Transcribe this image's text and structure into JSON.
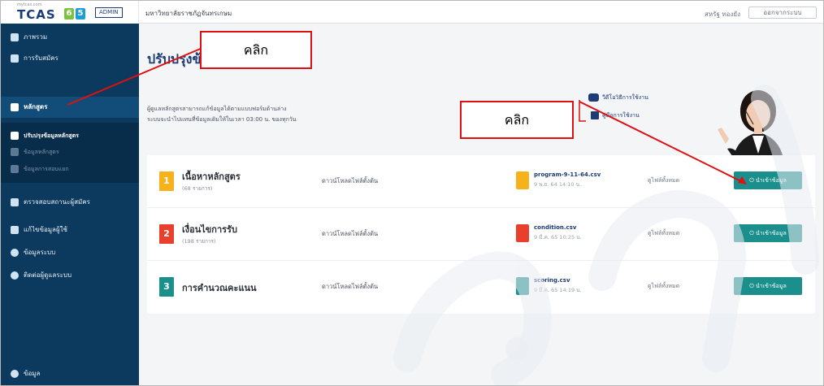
{
  "header": {
    "logo_sub": "mytcas.com",
    "logo_text": "TCAS",
    "logo_year_a": "6",
    "logo_year_b": "5",
    "admin_badge": "ADMIN",
    "university": "มหาวิทยาลัยราชภัฏจันทรเกษม",
    "user_name": "สหรัฐ ทองยัง",
    "logout_label": "ออกจากระบบ"
  },
  "sidebar": {
    "items": [
      {
        "label": "ภาพรวม",
        "icon": "building-icon"
      },
      {
        "label": "การรับสมัคร",
        "icon": "grid-icon"
      },
      {
        "label": "หลักสูตร",
        "icon": "curriculum-icon"
      },
      {
        "label": "ปรับปรุงข้อมูลหลักสูตร",
        "icon": "curriculum-edit-icon"
      },
      {
        "label": "ข้อมูลหลักสูตร",
        "icon": "list-icon"
      },
      {
        "label": "ข้อมูลการสอบแยก",
        "icon": "list-icon"
      },
      {
        "label": "ตรวจสอบสถานะผู้สมัคร",
        "icon": "people-icon"
      },
      {
        "label": "แก้ไขข้อมูลผู้ใช้",
        "icon": "user-group-icon"
      },
      {
        "label": "ข้อมูลระบบ",
        "icon": "info-icon"
      },
      {
        "label": "ติดต่อผู้ดูแลระบบ",
        "icon": "phone-icon"
      },
      {
        "label": "ข้อมูล",
        "icon": "info-circle-icon"
      }
    ]
  },
  "main": {
    "title": "ปรับปรุงข้อมูลหลักสูตร",
    "desc_line1": "ผู้ดูแลหลักสูตรสามารถแก้ข้อมูลได้ตามแบบฟอร์มด้านล่าง",
    "desc_line2": "ระบบจะนำไปแทนที่ข้อมูลเดิมให้ในเวลา 03:00 น. ของทุกวัน",
    "help_video": "วีดีโอวิธีการใช้งาน",
    "help_manual": "คู่มือการใช้งาน",
    "download_label": "ดาวน์โหลดไฟล์ตั้งต้น",
    "all_files_label": "ดูไฟล์ทั้งหมด",
    "import_label": "นำเข้าข้อมูล",
    "rows": [
      {
        "num": "1",
        "title": "เนื้อหาหลักสูตร",
        "count": "(68 รายการ)",
        "file": "program-9-11-64.csv",
        "date": "9 พ.ย. 64 14:10 น.",
        "num_color": "#f5b21b",
        "file_color": "#f5b21b"
      },
      {
        "num": "2",
        "title": "เงื่อนไขการรับ",
        "count": "(198 รายการ)",
        "file": "condition.csv",
        "date": "9 มี.ค. 65 10:25 น.",
        "num_color": "#e8402c",
        "file_color": "#e8402c"
      },
      {
        "num": "3",
        "title": "การคำนวณคะแนน",
        "count": "",
        "file": "scoring.csv",
        "date": "9 มี.ค. 65 14:19 น.",
        "num_color": "#1a8f8c",
        "file_color": "#1a8f8c"
      }
    ]
  },
  "callouts": {
    "click_top": "คลิก",
    "click_right": "คลิก"
  },
  "colors": {
    "sidebar_bg": "#0b3a5e",
    "accent_teal": "#1a8f8c",
    "brand_blue": "#1c3c78",
    "callout_red": "#e01010"
  }
}
